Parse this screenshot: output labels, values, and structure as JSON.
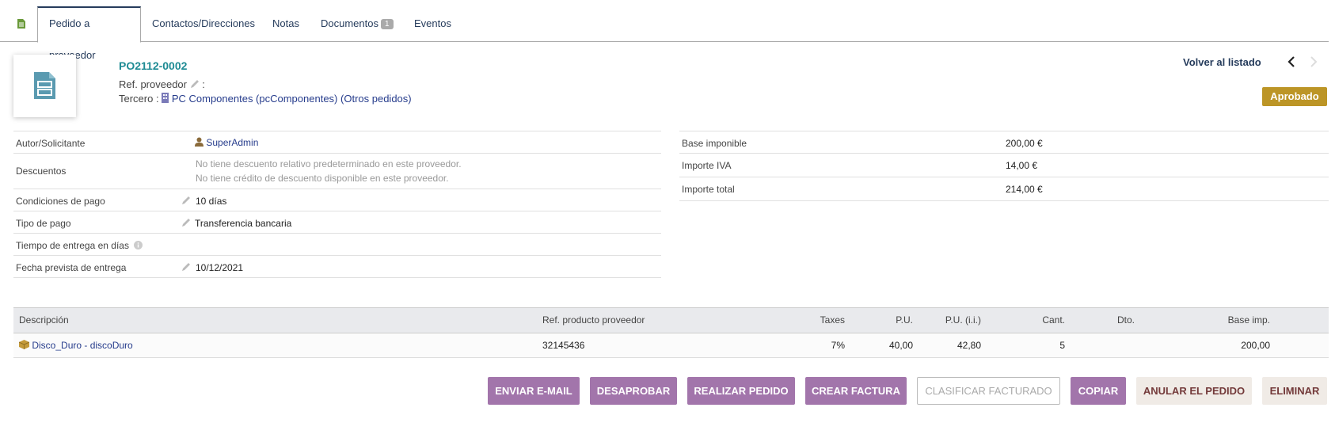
{
  "tabs": [
    {
      "label": "Pedido a proveedor",
      "active": true
    },
    {
      "label": "Contactos/Direcciones"
    },
    {
      "label": "Notas"
    },
    {
      "label": "Documentos",
      "badge": "1"
    },
    {
      "label": "Eventos"
    }
  ],
  "header": {
    "ref": "PO2112-0002",
    "ref_proveedor_label": "Ref. proveedor",
    "ref_proveedor_sep": ":",
    "tercero_label": "Tercero :",
    "tercero_name": "PC Componentes (pcComponentes)",
    "otros_pedidos": "(Otros pedidos)",
    "back_label": "Volver al listado",
    "status": "Aprobado"
  },
  "info": {
    "autor_label": "Autor/Solicitante",
    "autor_value": "SuperAdmin",
    "descuentos_label": "Descuentos",
    "descuentos_line1": "No tiene descuento relativo predeterminado en este proveedor.",
    "descuentos_line2": "No tiene crédito de descuento disponible en este proveedor.",
    "condiciones_label": "Condiciones de pago",
    "condiciones_value": "10 días",
    "tipo_label": "Tipo de pago",
    "tipo_value": "Transferencia bancaria",
    "tiempo_label": "Tiempo de entrega en días",
    "fecha_label": "Fecha prevista de entrega",
    "fecha_value": "10/12/2021"
  },
  "totals": {
    "base_label": "Base imponible",
    "base_value": "200,00 €",
    "iva_label": "Importe IVA",
    "iva_value": "14,00 €",
    "total_label": "Importe total",
    "total_value": "214,00 €"
  },
  "lines": {
    "headers": {
      "descripcion": "Descripción",
      "ref": "Ref. producto proveedor",
      "taxes": "Taxes",
      "pu": "P.U.",
      "pu_ii": "P.U. (i.i.)",
      "cant": "Cant.",
      "dto": "Dto.",
      "base": "Base imp."
    },
    "rows": [
      {
        "descripcion": "Disco_Duro - discoDuro",
        "ref": "32145436",
        "taxes": "7%",
        "pu": "40,00",
        "pu_ii": "42,80",
        "cant": "5",
        "dto": "",
        "base": "200,00"
      }
    ]
  },
  "buttons": {
    "email": "ENVIAR E-MAIL",
    "desaprobar": "DESAPROBAR",
    "realizar": "REALIZAR PEDIDO",
    "crear_factura": "CREAR FACTURA",
    "clasificar": "CLASIFICAR FACTURADO",
    "copiar": "COPIAR",
    "anular": "ANULAR EL PEDIDO",
    "eliminar": "ELIMINAR"
  },
  "colors": {
    "accent": "#263c5c",
    "ref": "#1e8b94",
    "status": "#bc9526",
    "button": "#a275ab"
  },
  "icons": [
    "document-icon",
    "order-icon",
    "pencil-icon",
    "building-icon",
    "user-icon",
    "info-icon",
    "product-icon",
    "chevron-left-icon",
    "chevron-right-icon"
  ]
}
